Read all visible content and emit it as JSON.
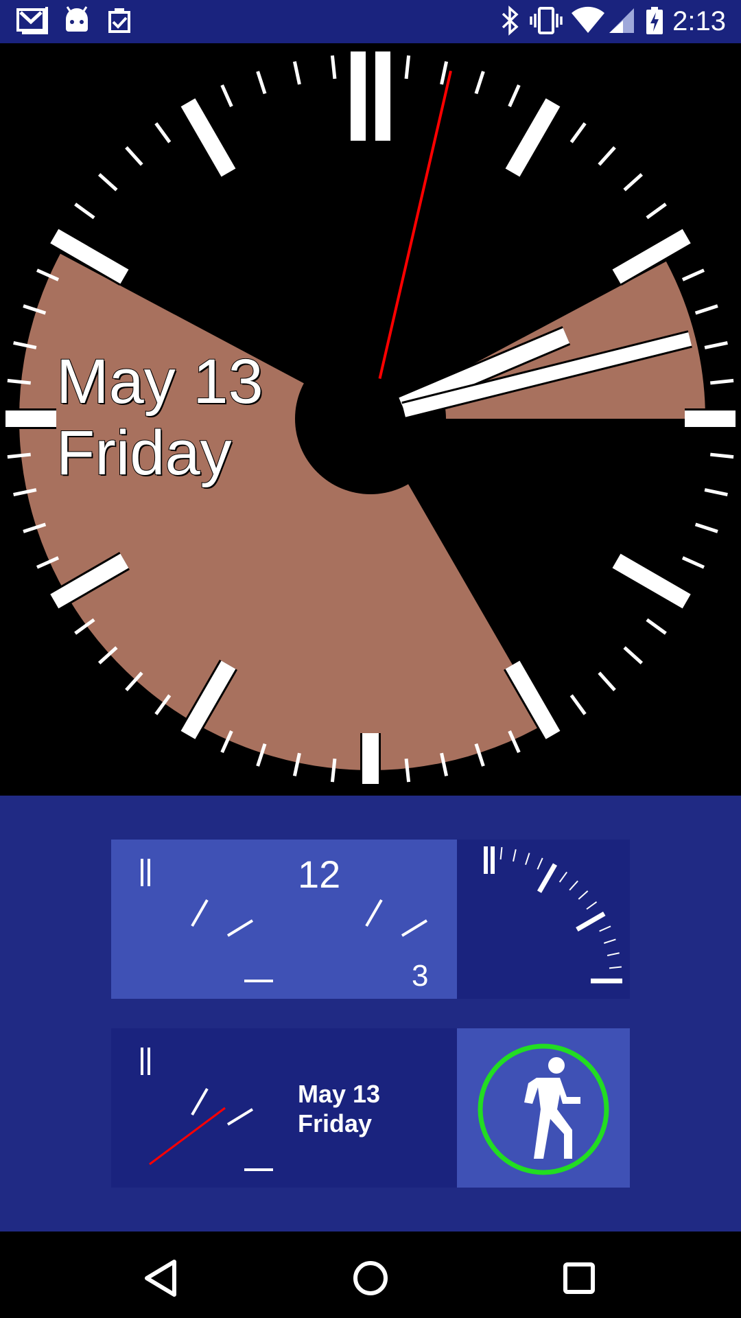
{
  "status_bar": {
    "time": "2:13",
    "left_icons": [
      "gmail-icon",
      "android-icon",
      "clipboard-check-icon"
    ],
    "right_icons": [
      "bluetooth-icon",
      "vibrate-icon",
      "wifi-icon",
      "cellular-signal-icon",
      "battery-charging-icon"
    ]
  },
  "watch_face": {
    "date_line1": "May 13",
    "date_line2": "Friday",
    "colors": {
      "background": "#000000",
      "sector": "#a8715e",
      "second_hand": "#ff0000",
      "ticks": "#ffffff"
    }
  },
  "complications": {
    "tile1": {
      "number_12": "12",
      "number_3": "3"
    },
    "tile3": {
      "date_line1": "May 13",
      "date_line2": "Friday"
    },
    "tile4": {
      "icon": "walking-person-icon",
      "ring_color": "#22dd22"
    },
    "colors": {
      "light_tile": "#3f51b5",
      "dark_tile": "#1a237e",
      "panel": "#202a84"
    }
  },
  "nav_bar": {
    "buttons": [
      "back-icon",
      "home-icon",
      "recents-icon"
    ]
  }
}
